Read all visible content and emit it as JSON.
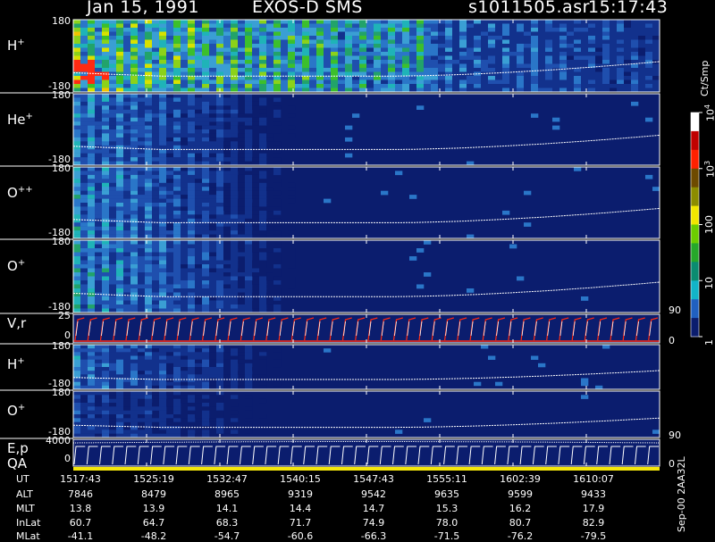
{
  "header": {
    "date": "Jan 15, 1991",
    "mission": "EXOS-D SMS",
    "file": "s1011505.asr",
    "time": "15:17:43"
  },
  "colors": {
    "background": "#000000",
    "panel_fill": "#0b1d6e",
    "axis": "#ffffff",
    "trace": "#ffffff",
    "velocity_red": "#ff2a12",
    "qa_yellow": "#f4e60a"
  },
  "panels": [
    {
      "label": "H",
      "sup": "+",
      "ymax": "180",
      "ymin": "-180",
      "activity": 1.0,
      "right_label": ""
    },
    {
      "label": "He",
      "sup": "+",
      "ymax": "180",
      "ymin": "-180",
      "activity": 0.45,
      "right_label": ""
    },
    {
      "label": "O",
      "sup": "++",
      "ymax": "180",
      "ymin": "-180",
      "activity": 0.5,
      "right_label": ""
    },
    {
      "label": "O",
      "sup": "+",
      "ymax": "180",
      "ymin": "-180",
      "activity": 0.55,
      "right_label": "90"
    },
    {
      "label": "V,r",
      "sup": "",
      "ymax": "25",
      "ymin": "0",
      "activity": 0,
      "right_label": "0"
    },
    {
      "label": "H",
      "sup": "+",
      "ymax": "180",
      "ymin": "-180",
      "activity": 0.4,
      "right_label": ""
    },
    {
      "label": "O",
      "sup": "+",
      "ymax": "180",
      "ymin": "-180",
      "activity": 0.25,
      "right_label": "90"
    },
    {
      "label": "E,p",
      "sup": "",
      "ymax": "4000",
      "ymin": "0",
      "activity": 0,
      "right_label": "0"
    }
  ],
  "qa_label": "QA",
  "colorbar": {
    "unit": "Ct/Smp",
    "ticks": [
      {
        "label": "10",
        "sup": "4",
        "frac": 1.0
      },
      {
        "label": "10",
        "sup": "3",
        "frac": 0.75
      },
      {
        "label": "100",
        "sup": "",
        "frac": 0.5
      },
      {
        "label": "10",
        "sup": "",
        "frac": 0.25
      },
      {
        "label": "1",
        "sup": "",
        "frac": 0.0
      }
    ],
    "stops": [
      "#ffffff",
      "#c00000",
      "#ff2000",
      "#6e4a00",
      "#8c8c00",
      "#f2e600",
      "#6ccd00",
      "#26a82a",
      "#0a8c70",
      "#12b4c8",
      "#2060c0",
      "#0b1d6e"
    ]
  },
  "footer_id": "Sep-00 2AA32L",
  "table": {
    "rows": [
      {
        "name": "UT",
        "values": [
          "1517:43",
          "1525:19",
          "1532:47",
          "1540:15",
          "1547:43",
          "1555:11",
          "1602:39",
          "1610:07"
        ]
      },
      {
        "name": "ALT",
        "values": [
          "7846",
          "8479",
          "8965",
          "9319",
          "9542",
          "9635",
          "9599",
          "9433"
        ]
      },
      {
        "name": "MLT",
        "values": [
          "13.8",
          "13.9",
          "14.1",
          "14.4",
          "14.7",
          "15.3",
          "16.2",
          "17.9"
        ]
      },
      {
        "name": "InLat",
        "values": [
          "60.7",
          "64.7",
          "68.3",
          "71.7",
          "74.9",
          "78.0",
          "80.7",
          "82.9"
        ]
      },
      {
        "name": "MLat",
        "values": [
          "-41.1",
          "-48.2",
          "-54.7",
          "-60.6",
          "-66.3",
          "-71.5",
          "-76.2",
          "-79.5"
        ]
      }
    ]
  },
  "chart_data": {
    "type": "heatmap",
    "title": "Jan 15, 1991   EXOS-D SMS",
    "x_ticks": [
      "1517:43",
      "1525:19",
      "1532:47",
      "1540:15",
      "1547:43",
      "1555:11",
      "1602:39",
      "1610:07"
    ],
    "series": [
      {
        "name": "H+",
        "ylim": [
          -180,
          180
        ]
      },
      {
        "name": "He+",
        "ylim": [
          -180,
          180
        ]
      },
      {
        "name": "O++",
        "ylim": [
          -180,
          180
        ]
      },
      {
        "name": "O+",
        "ylim": [
          -180,
          180
        ]
      },
      {
        "name": "V,r",
        "ylim": [
          0,
          25
        ]
      },
      {
        "name": "H+",
        "ylim": [
          -180,
          180
        ]
      },
      {
        "name": "O+",
        "ylim": [
          -180,
          180
        ]
      },
      {
        "name": "E,p",
        "ylim": [
          0,
          4000
        ]
      }
    ],
    "color_scale": {
      "label": "Ct/Smp",
      "scale": "log",
      "range": [
        1,
        10000
      ]
    }
  }
}
